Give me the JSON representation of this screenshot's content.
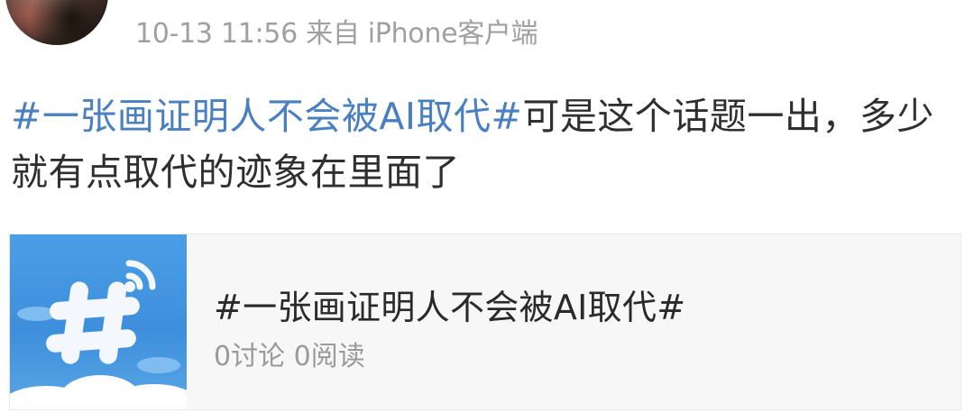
{
  "post": {
    "meta": {
      "timestamp": "10-13 11:56",
      "source": "来自 iPhone客户端"
    },
    "topic_link": "#一张画证明人不会被AI取代#",
    "text_rest": "可是这个话题一出，多少就有点取代的迹象在里面了"
  },
  "topic_card": {
    "icon": "topic-hash-icon",
    "title": "#一张画证明人不会被AI取代#",
    "discussions": "0讨论",
    "reads": "0阅读"
  },
  "colors": {
    "link": "#4a80c0",
    "meta": "#a0a0a0",
    "text": "#2f2f2f",
    "card_bg": "#f7f7f7",
    "thumb_blue": "#3d8fdc"
  }
}
